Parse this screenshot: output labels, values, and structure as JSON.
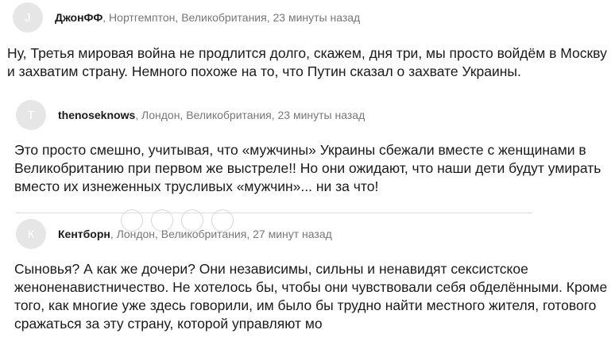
{
  "comments": [
    {
      "avatar_letter": "J",
      "author": "ДжонФФ",
      "meta": ", Нортгемптон, Великобритания, 23 минуты назад",
      "body": "Ну, Третья мировая война не продлится долго, скажем, дня три, мы просто войдём в Москву и захватим страну. Немного похоже на то, что Путин сказал о захвате Украины."
    },
    {
      "avatar_letter": "T",
      "author": "thenoseknows",
      "meta": ", Лондон, Великобритания, 23 минуты назад",
      "body": "Это просто смешно, учитывая, что «мужчины» Украины сбежали вместе с женщинами в Великобританию при первом же выстреле!! Но они ожидают, что наши дети будут умирать вместо их изнеженных трусливых «мужчин»... ни за что!"
    },
    {
      "avatar_letter": "К",
      "author": "Кентборн",
      "meta": ", Лондон, Великобритания, 27 минут назад",
      "body": "Сыновья? А как же дочери? Они независимы, сильны и ненавидят сексистское женоненавистничество. Не хотелось бы, чтобы они чувствовали себя обделёнными. Кроме того, как многие уже здесь говорили, им было бы трудно найти местного жителя, готового сражаться за эту страну, которой управляют мо"
    }
  ],
  "colors": {
    "avatar_bg": "#e6e6e6",
    "meta_text": "#777777",
    "body_text": "#1a1a1a"
  }
}
